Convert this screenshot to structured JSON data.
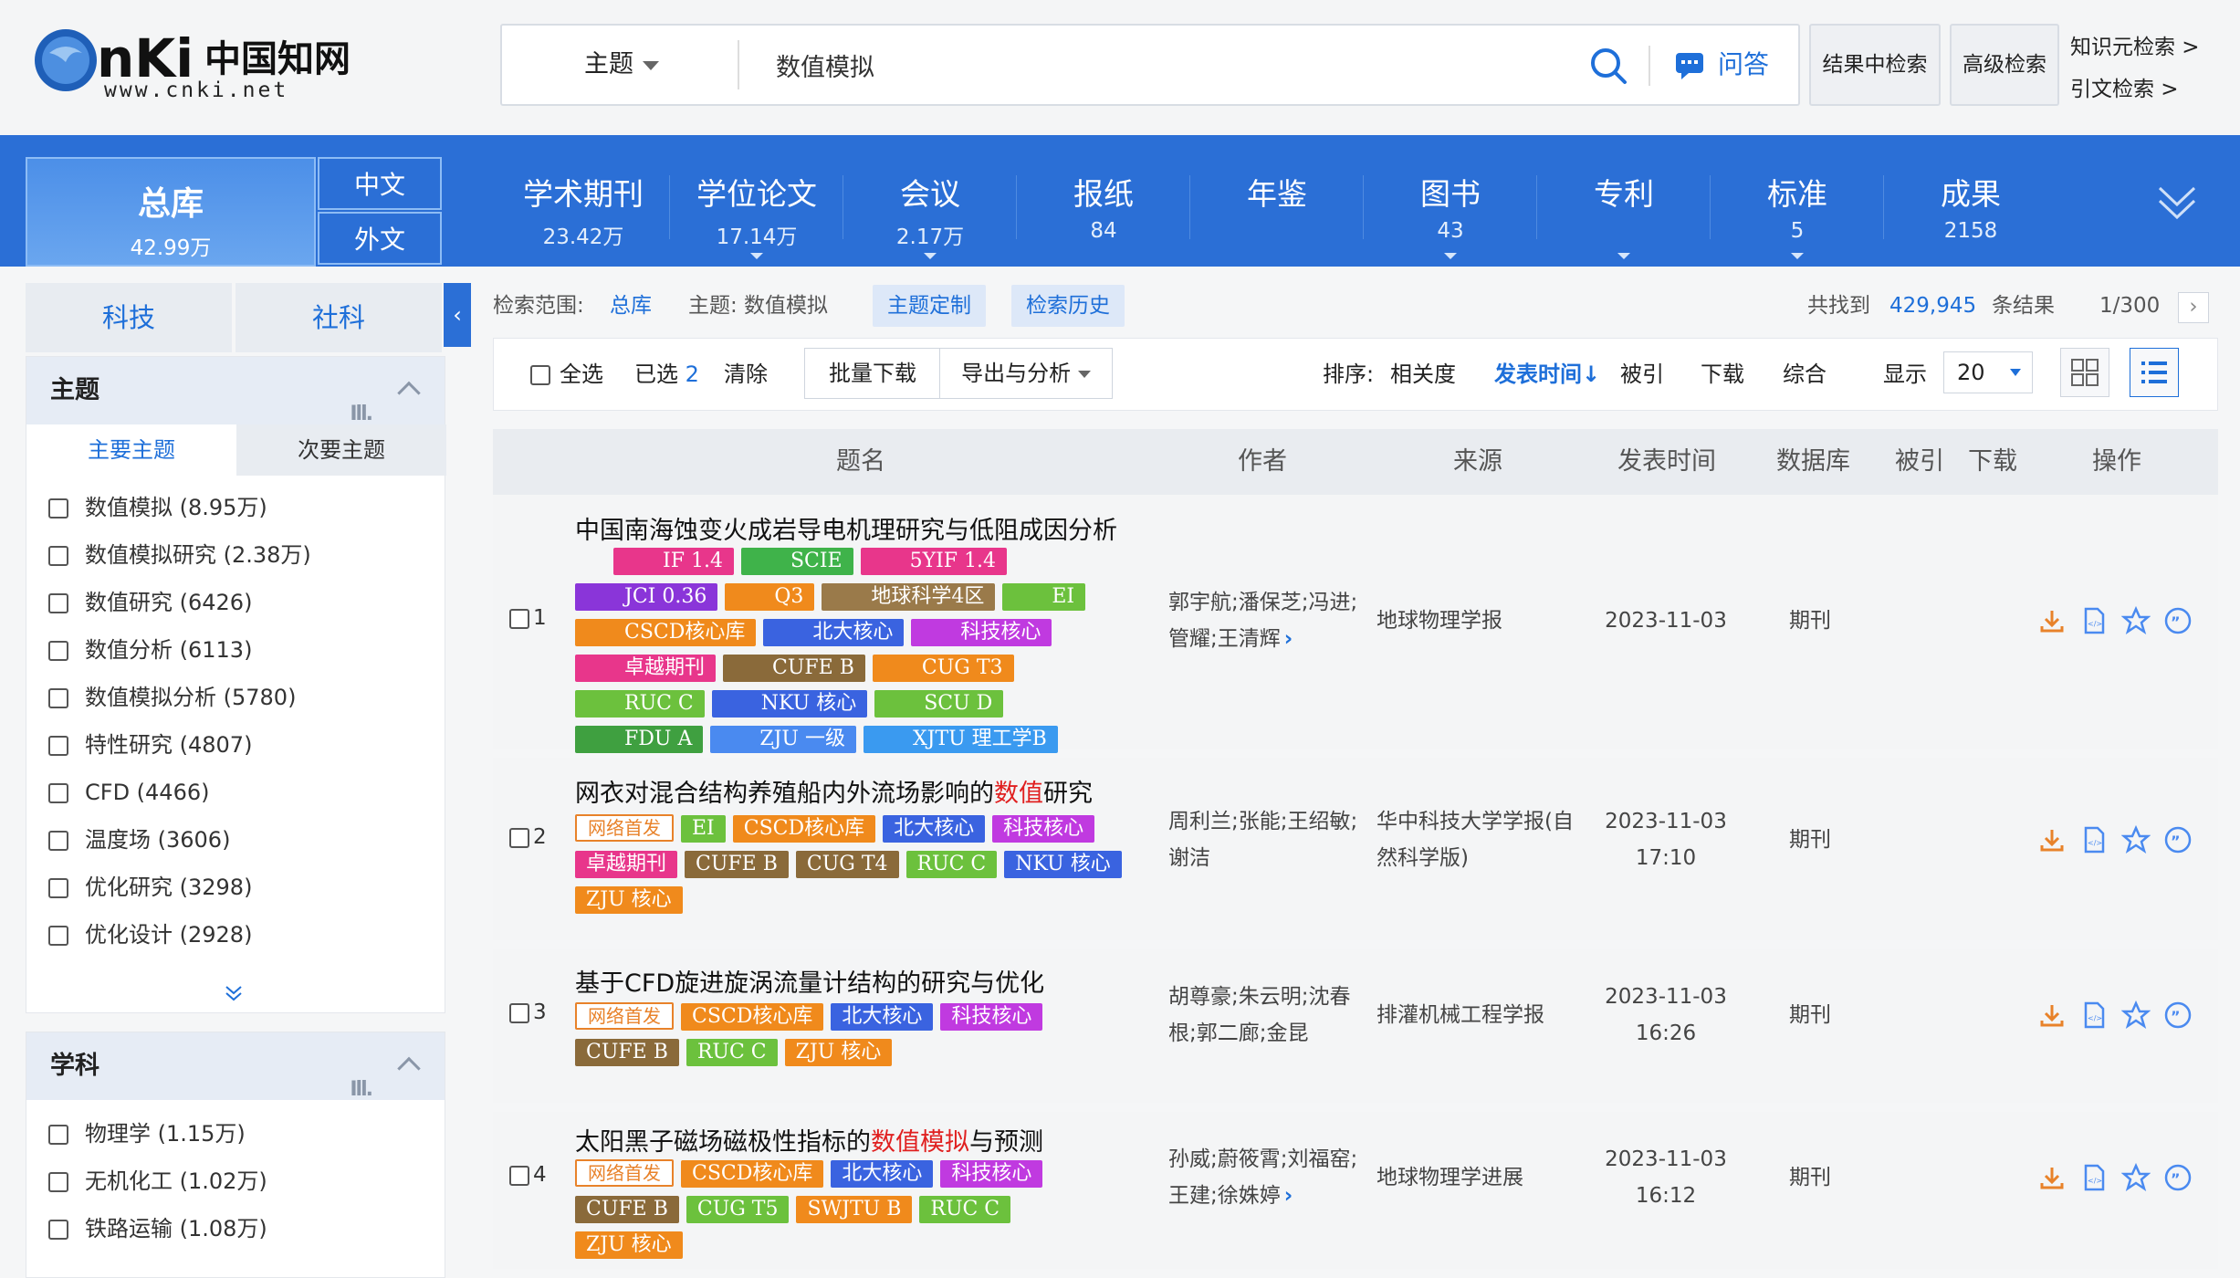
{
  "header": {
    "logo_text": "www.cnki.net",
    "logo_cn": "中国知网",
    "search": {
      "field": "主题",
      "query": "数值模拟",
      "qa_label": "问答"
    },
    "buttons": [
      "结果中检索",
      "高级检索"
    ],
    "links": [
      "知识元检索 >",
      "引文检索 >"
    ]
  },
  "nav": {
    "total": {
      "label": "总库",
      "count": "42.99万"
    },
    "lang": [
      "中文",
      "外文"
    ],
    "items": [
      {
        "label": "学术期刊",
        "count": "23.42万"
      },
      {
        "label": "学位论文",
        "count": "17.14万"
      },
      {
        "label": "会议",
        "count": "2.17万"
      },
      {
        "label": "报纸",
        "count": "84"
      },
      {
        "label": "年鉴",
        "count": ""
      },
      {
        "label": "图书",
        "count": "43"
      },
      {
        "label": "专利",
        "count": ""
      },
      {
        "label": "标准",
        "count": "5"
      },
      {
        "label": "成果",
        "count": "2158"
      }
    ]
  },
  "sidebar": {
    "tabs": [
      "科技",
      "社科"
    ],
    "facet1": {
      "title": "主题",
      "subtabs": [
        "主要主题",
        "次要主题"
      ],
      "items": [
        "数值模拟 (8.95万)",
        "数值模拟研究 (2.38万)",
        "数值研究 (6426)",
        "数值分析 (6113)",
        "数值模拟分析 (5780)",
        "特性研究 (4807)",
        "CFD (4466)",
        "温度场 (3606)",
        "优化研究 (3298)",
        "优化设计 (2928)"
      ]
    },
    "facet2": {
      "title": "学科",
      "items": [
        "物理学 (1.15万)",
        "无机化工 (1.02万)",
        "铁路运输 (1.08万)"
      ]
    }
  },
  "main": {
    "crumbs": {
      "scope_label": "检索范围:",
      "scope": "总库",
      "topic": "主题: 数值模拟",
      "chip1": "主题定制",
      "chip2": "检索历史",
      "found_prefix": "共找到",
      "found_count": "429,945",
      "found_suffix": "条结果",
      "page": "1/300"
    },
    "toolbar": {
      "select_all": "全选",
      "selected_label": "已选",
      "selected_count": "2",
      "clear": "清除",
      "batch_download": "批量下载",
      "export": "导出与分析",
      "sort_label": "排序:",
      "sort_options": [
        "相关度",
        "发表时间",
        "被引",
        "下载",
        "综合"
      ],
      "display_label": "显示",
      "display_value": "20"
    },
    "columns": [
      "题名",
      "作者",
      "来源",
      "发表时间",
      "数据库",
      "被引",
      "下载",
      "操作"
    ],
    "rows": [
      {
        "num": "1",
        "title_pre": "中国南海蚀变火成岩导电机理研究与低阻成因分析",
        "title_hl": "",
        "title_post": "",
        "authors": "郭宇航;潘保芝;冯进;管耀;王清辉",
        "more": "›",
        "source": "地球物理学报",
        "date": "2023-11-03",
        "time": "",
        "db": "期刊",
        "tags": [
          {
            "t": "IF 1.4",
            "c": "#e8368b"
          },
          {
            "t": "SCIE",
            "c": "#3fb34a"
          },
          {
            "t": "5YIF 1.4",
            "c": "#e8368b"
          },
          {
            "t": "JCI 0.36",
            "c": "#8a35d9"
          },
          {
            "t": "Q3",
            "c": "#f08a1c"
          },
          {
            "t": "地球科学4区",
            "c": "#9a7a4a"
          },
          {
            "t": "EI",
            "c": "#6cc13d"
          },
          {
            "t": "CSCD核心库",
            "c": "#f08a1c"
          },
          {
            "t": "北大核心",
            "c": "#3a63e0"
          },
          {
            "t": "科技核心",
            "c": "#c03ae0"
          },
          {
            "t": "卓越期刊",
            "c": "#e8368b"
          },
          {
            "t": "CUFE B",
            "c": "#8a6a3a"
          },
          {
            "t": "CUG T3",
            "c": "#f08a1c"
          },
          {
            "t": "RUC C",
            "c": "#6cc13d"
          },
          {
            "t": "NKU 核心",
            "c": "#3a63e0"
          },
          {
            "t": "SCU D",
            "c": "#6cc13d"
          },
          {
            "t": "FDU A",
            "c": "#3fa040"
          },
          {
            "t": "ZJU 一级",
            "c": "#4a8af0"
          },
          {
            "t": "XJTU 理工学B",
            "c": "#3a9af0"
          }
        ]
      },
      {
        "num": "2",
        "title_pre": "网衣对混合结构养殖船内外流场影响的",
        "title_hl": "数值",
        "title_post": "研究",
        "authors": "周利兰;张能;王绍敏;谢洁",
        "more": "",
        "source": "华中科技大学学报(自然科学版)",
        "date": "2023-11-03",
        "time": "17:10",
        "db": "期刊",
        "tags": [
          {
            "t": "网络首发",
            "c": "net"
          },
          {
            "t": "EI",
            "c": "#6cc13d"
          },
          {
            "t": "CSCD核心库",
            "c": "#f08a1c"
          },
          {
            "t": "北大核心",
            "c": "#3a63e0"
          },
          {
            "t": "科技核心",
            "c": "#c03ae0"
          },
          {
            "t": "卓越期刊",
            "c": "#e8368b"
          },
          {
            "t": "CUFE B",
            "c": "#8a6a3a"
          },
          {
            "t": "CUG T4",
            "c": "#8a6a3a"
          },
          {
            "t": "RUC C",
            "c": "#6cc13d"
          },
          {
            "t": "NKU 核心",
            "c": "#3a63e0"
          },
          {
            "t": "ZJU 核心",
            "c": "#f08a1c"
          }
        ]
      },
      {
        "num": "3",
        "title_pre": "基于CFD旋进旋涡流量计结构的研究与优化",
        "title_hl": "",
        "title_post": "",
        "authors": "胡尊豪;朱云明;沈春根;郭二廊;金昆",
        "more": "",
        "source": "排灌机械工程学报",
        "date": "2023-11-03",
        "time": "16:26",
        "db": "期刊",
        "tags": [
          {
            "t": "网络首发",
            "c": "net"
          },
          {
            "t": "CSCD核心库",
            "c": "#f08a1c"
          },
          {
            "t": "北大核心",
            "c": "#3a63e0"
          },
          {
            "t": "科技核心",
            "c": "#c03ae0"
          },
          {
            "t": "CUFE B",
            "c": "#8a6a3a"
          },
          {
            "t": "RUC C",
            "c": "#6cc13d"
          },
          {
            "t": "ZJU 核心",
            "c": "#f08a1c"
          }
        ]
      },
      {
        "num": "4",
        "title_pre": "太阳黑子磁场磁极性指标的",
        "title_hl": "数值模拟",
        "title_post": "与预测",
        "authors": "孙威;蔚筱霄;刘福窑;王建;徐姝婷",
        "more": "›",
        "source": "地球物理学进展",
        "date": "2023-11-03",
        "time": "16:12",
        "db": "期刊",
        "tags": [
          {
            "t": "网络首发",
            "c": "net"
          },
          {
            "t": "CSCD核心库",
            "c": "#f08a1c"
          },
          {
            "t": "北大核心",
            "c": "#3a63e0"
          },
          {
            "t": "科技核心",
            "c": "#c03ae0"
          },
          {
            "t": "CUFE B",
            "c": "#8a6a3a"
          },
          {
            "t": "CUG T5",
            "c": "#6cc13d"
          },
          {
            "t": "SWJTU B",
            "c": "#f08a1c"
          },
          {
            "t": "RUC C",
            "c": "#6cc13d"
          },
          {
            "t": "ZJU 核心",
            "c": "#f08a1c"
          }
        ]
      }
    ]
  }
}
